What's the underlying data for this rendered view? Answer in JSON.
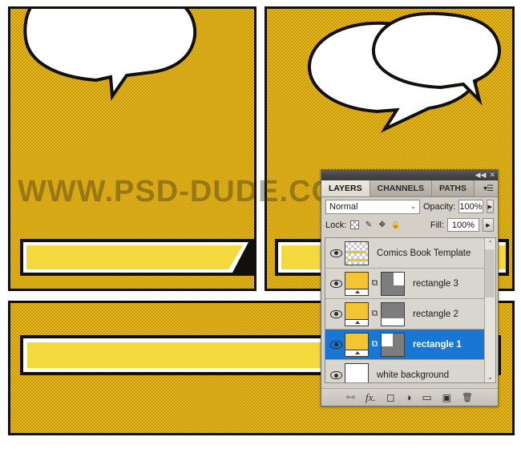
{
  "artboard": {
    "watermark_text": "WWW.PSD-DUDE.COM",
    "colors": {
      "halftone_light": "#e5b61f",
      "halftone_dark": "#c99a0c",
      "panel_border": "#12100c",
      "caption_fill": "#f4d93c",
      "bubble_fill": "#ffffff"
    },
    "panels": [
      {
        "name": "top-left-panel",
        "has_bubble": true,
        "has_caption": true
      },
      {
        "name": "top-right-panel",
        "has_bubble": true,
        "has_caption": true
      },
      {
        "name": "bottom-panel",
        "has_bubble": false,
        "has_caption": true
      }
    ]
  },
  "panel": {
    "titlebar": {
      "collapse_label": "◀◀",
      "close_label": "✕"
    },
    "tabs": [
      {
        "label": "LAYERS",
        "active": true
      },
      {
        "label": "CHANNELS",
        "active": false
      },
      {
        "label": "PATHS",
        "active": false
      }
    ],
    "menu_icon": "panel-menu-icon",
    "blend_mode": {
      "value": "Normal",
      "chevron": "⌄"
    },
    "opacity": {
      "label": "Opacity:",
      "value": "100%",
      "spinner": "▶"
    },
    "fill": {
      "label": "Fill:",
      "value": "100%",
      "spinner": "▶"
    },
    "lock": {
      "label": "Lock:",
      "icons": [
        {
          "name": "lock-transparent-pixels-icon",
          "glyph": ""
        },
        {
          "name": "lock-image-pixels-icon",
          "glyph": "✎"
        },
        {
          "name": "lock-position-icon",
          "glyph": "✥"
        },
        {
          "name": "lock-all-icon",
          "glyph": "🔒"
        }
      ]
    },
    "layers": [
      {
        "name": "Comics Book Template",
        "visible": true,
        "selected": false,
        "thumb_type": "checker",
        "has_mask": false
      },
      {
        "name": "rectangle 3",
        "visible": true,
        "selected": false,
        "thumb_type": "yellow",
        "has_mask": true,
        "mask_style": "white-top-right"
      },
      {
        "name": "rectangle  2",
        "visible": true,
        "selected": false,
        "thumb_type": "yellow",
        "has_mask": true,
        "mask_style": "white-bottom-strip"
      },
      {
        "name": "rectangle  1",
        "visible": true,
        "selected": true,
        "thumb_type": "yellow",
        "has_mask": true,
        "mask_style": "white-left-square"
      },
      {
        "name": "white background",
        "visible": true,
        "selected": false,
        "thumb_type": "white",
        "has_mask": false
      }
    ],
    "scrollbar": {
      "up": "⌃",
      "down": "⌄"
    },
    "footer_buttons": [
      {
        "name": "link-layers-button",
        "glyph": "⧟"
      },
      {
        "name": "layer-style-fx-button",
        "glyph": "fx."
      },
      {
        "name": "add-layer-mask-button",
        "glyph": "◻"
      },
      {
        "name": "adjustment-layer-button",
        "glyph": "◑"
      },
      {
        "name": "new-group-button",
        "glyph": "▭"
      },
      {
        "name": "new-layer-button",
        "glyph": "▣"
      },
      {
        "name": "delete-layer-button",
        "glyph": "🗑"
      }
    ],
    "accent_color": "#1877d4"
  }
}
